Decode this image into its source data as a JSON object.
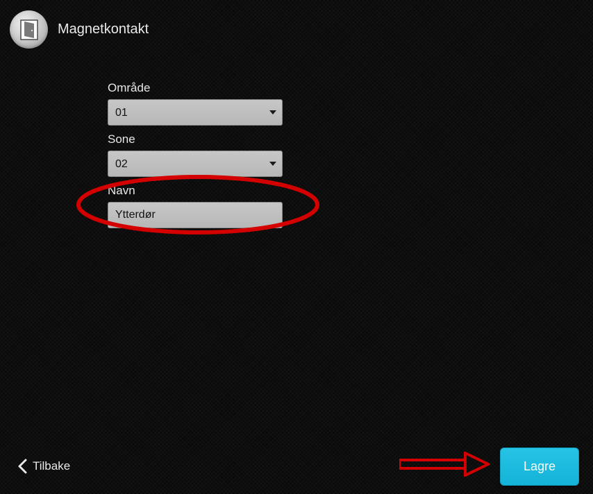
{
  "header": {
    "title": "Magnetkontakt"
  },
  "form": {
    "area": {
      "label": "Område",
      "value": "01"
    },
    "zone": {
      "label": "Sone",
      "value": "02"
    },
    "name": {
      "label": "Navn",
      "value": "Ytterdør"
    }
  },
  "footer": {
    "back_label": "Tilbake",
    "save_label": "Lagre"
  }
}
